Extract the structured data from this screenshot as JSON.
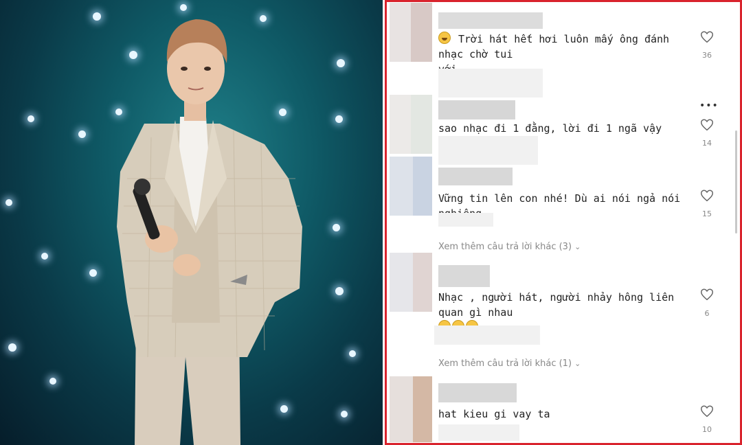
{
  "comments": [
    {
      "text": "Trời hát hết hơi luôn mấy ông đánh nhạc chờ tui",
      "text2": "với",
      "likes": "36",
      "emoji": "grinning-face"
    },
    {
      "text": "sao nhạc đi 1 đằng, lời đi 1 ngã vậy",
      "likes": "14"
    },
    {
      "text": "Vững tin lên con nhé! Dù ai nói ngả nói nghiêng",
      "likes": "15"
    },
    {
      "text": "Nhạc , người hát, người nhảy hông liên quan gì nhau",
      "likes": "6",
      "emoji": "rolling-laughing-face"
    },
    {
      "text": "hat kieu gi vay ta",
      "likes": "10"
    }
  ],
  "view_more": [
    {
      "label": "Xem thêm câu trả lời khác (3)"
    },
    {
      "label": "Xem thêm câu trả lời khác (1)"
    }
  ],
  "more_menu": {
    "label": "•••"
  },
  "colors": {
    "highlight_border": "#d9232d",
    "photo_bg": "#0f5a66"
  }
}
